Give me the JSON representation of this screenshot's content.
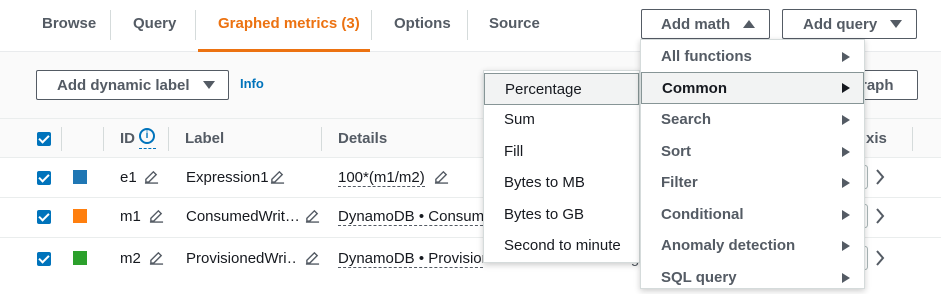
{
  "tabs": [
    {
      "label": "Browse"
    },
    {
      "label": "Query"
    },
    {
      "label": "Graphed metrics (3)",
      "active": true
    },
    {
      "label": "Options"
    },
    {
      "label": "Source"
    }
  ],
  "header_buttons": {
    "add_math": "Add math",
    "add_query": "Add query"
  },
  "toolbar": {
    "add_dynamic_label": "Add dynamic label",
    "info": "Info",
    "partial_button": "raph"
  },
  "table": {
    "headers": {
      "id": "ID",
      "label": "Label",
      "details": "Details",
      "axis": "xis"
    },
    "rows": [
      {
        "color": "#1f77b4",
        "id": "e1",
        "label": "Expression1",
        "details": "100*(m1/m2)",
        "extra": ""
      },
      {
        "color": "#ff7f0e",
        "id": "m1",
        "label": "ConsumedWrit…",
        "details": "DynamoDB • Consume",
        "extra": ""
      },
      {
        "color": "#2ca02c",
        "id": "m2",
        "label": "ProvisionedWri…",
        "details": "DynamoDB • Provision",
        "extra": "Averag"
      }
    ]
  },
  "math_menu": {
    "items": [
      {
        "label": "All functions"
      },
      {
        "label": "Common"
      },
      {
        "label": "Search"
      },
      {
        "label": "Sort"
      },
      {
        "label": "Filter"
      },
      {
        "label": "Conditional"
      },
      {
        "label": "Anomaly detection"
      },
      {
        "label": "SQL query"
      }
    ]
  },
  "common_submenu": {
    "items": [
      {
        "label": "Percentage"
      },
      {
        "label": "Sum"
      },
      {
        "label": "Fill"
      },
      {
        "label": "Bytes to MB"
      },
      {
        "label": "Bytes to GB"
      },
      {
        "label": "Second to minute"
      }
    ]
  },
  "colors": {
    "accent": "#ec7211",
    "link": "#0073bb",
    "checkbox": "#0073bb"
  }
}
